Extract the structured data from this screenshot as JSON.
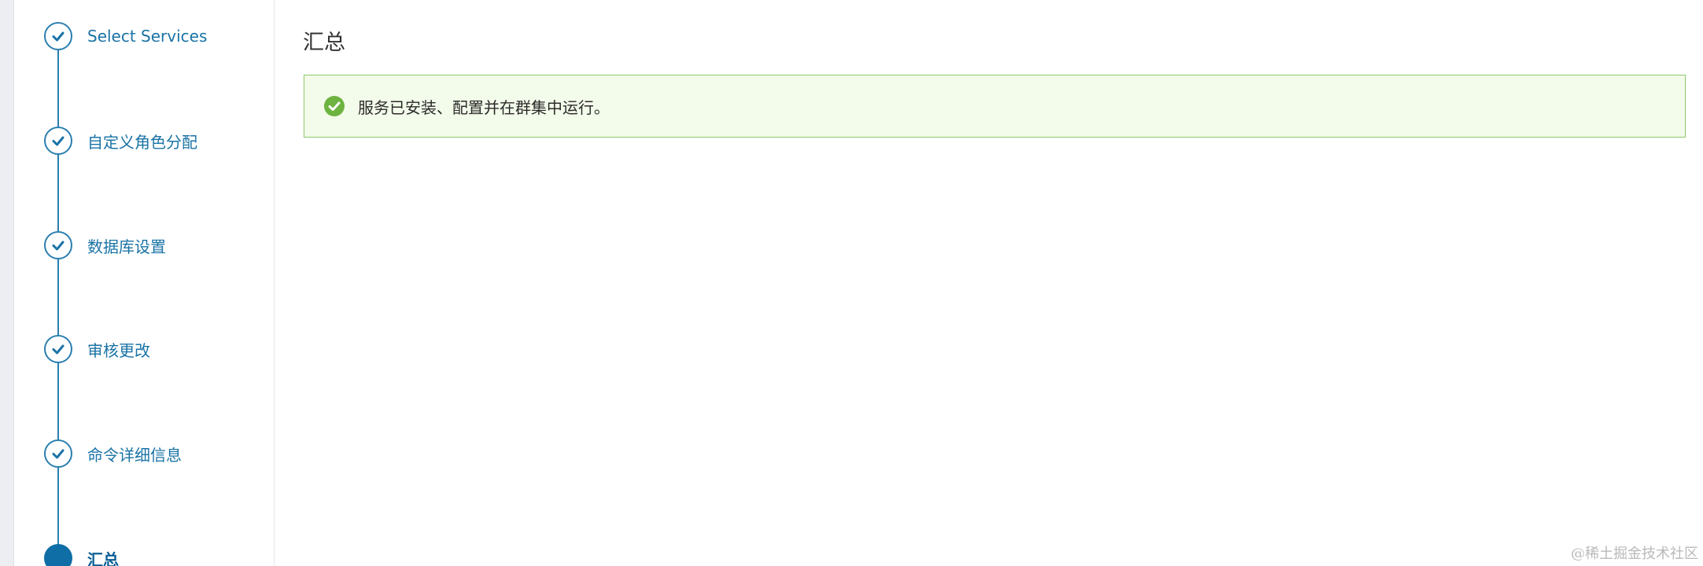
{
  "wizard": {
    "steps": [
      {
        "label": "Select Services",
        "status": "completed",
        "icon": "check-icon"
      },
      {
        "label": "自定义角色分配",
        "status": "completed",
        "icon": "check-icon"
      },
      {
        "label": "数据库设置",
        "status": "completed",
        "icon": "check-icon"
      },
      {
        "label": "审核更改",
        "status": "completed",
        "icon": "check-icon"
      },
      {
        "label": "命令详细信息",
        "status": "completed",
        "icon": "check-icon"
      },
      {
        "label": "汇总",
        "status": "current",
        "icon": "current-step-dot"
      }
    ]
  },
  "main": {
    "title": "汇总",
    "alert": {
      "type": "success",
      "icon": "check-circle-icon",
      "message": "服务已安装、配置并在群集中运行。"
    }
  },
  "watermark": "@稀土掘金技术社区",
  "colors": {
    "accent": "#1a73a6",
    "step_line": "#2a7fb0",
    "current_step": "#0f6ea6",
    "success_bg": "#f3fbea",
    "success_border": "#8cc86a",
    "success_icon": "#6db33f"
  }
}
